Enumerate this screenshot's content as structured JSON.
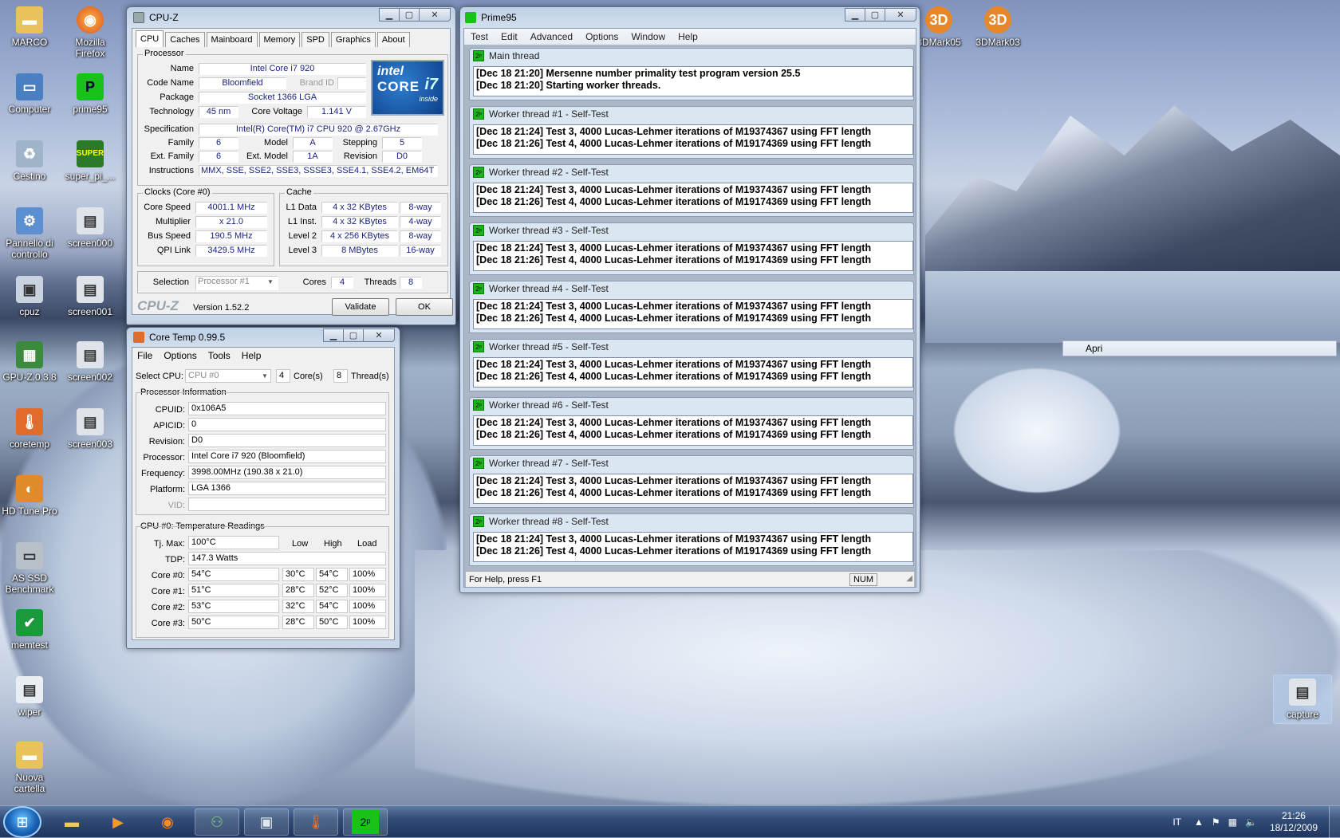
{
  "desktop_icons": [
    {
      "label": "MARCO",
      "icon": "folder-icon"
    },
    {
      "label": "Mozilla Firefox",
      "icon": "firefox-icon"
    },
    {
      "label": "Computer",
      "icon": "computer-icon"
    },
    {
      "label": "prime95",
      "icon": "prime95-icon"
    },
    {
      "label": "Cestino",
      "icon": "recycle-bin-icon"
    },
    {
      "label": "super_pi_...",
      "icon": "superpi-icon"
    },
    {
      "label": "Pannello di controllo",
      "icon": "control-panel-icon"
    },
    {
      "label": "screen000",
      "icon": "image-file-icon"
    },
    {
      "label": "cpuz",
      "icon": "cpuz-icon"
    },
    {
      "label": "screen001",
      "icon": "image-file-icon"
    },
    {
      "label": "GPU-Z.0.3.8",
      "icon": "gpuz-icon"
    },
    {
      "label": "screen002",
      "icon": "image-file-icon"
    },
    {
      "label": "coretemp",
      "icon": "coretemp-icon"
    },
    {
      "label": "screen003",
      "icon": "image-file-icon"
    },
    {
      "label": "HD Tune Pro",
      "icon": "hdtune-icon"
    },
    {
      "label": "AS SSD Benchmark",
      "icon": "asssd-icon"
    },
    {
      "label": "memtest",
      "icon": "memtest-icon"
    },
    {
      "label": "wiper",
      "icon": "wiper-icon"
    },
    {
      "label": "Nuova cartella",
      "icon": "folder-icon"
    },
    {
      "label": "3DMark05",
      "icon": "3dmark-icon"
    },
    {
      "label": "3DMark03",
      "icon": "3dmark-icon"
    },
    {
      "label": "capture",
      "icon": "image-file-icon"
    }
  ],
  "context_menu": {
    "item": "Apri"
  },
  "cpuz": {
    "title": "CPU-Z",
    "tabs": [
      "CPU",
      "Caches",
      "Mainboard",
      "Memory",
      "SPD",
      "Graphics",
      "About"
    ],
    "processor_group": "Processor",
    "labels": {
      "name": "Name",
      "code_name": "Code Name",
      "brand_id": "Brand ID",
      "package": "Package",
      "technology": "Technology",
      "core_voltage": "Core Voltage",
      "specification": "Specification",
      "family": "Family",
      "model": "Model",
      "stepping": "Stepping",
      "ext_family": "Ext. Family",
      "ext_model": "Ext. Model",
      "revision": "Revision",
      "instructions": "Instructions"
    },
    "values": {
      "name": "Intel Core i7 920",
      "code_name": "Bloomfield",
      "package": "Socket 1366 LGA",
      "technology": "45 nm",
      "core_voltage": "1.141 V",
      "specification": "Intel(R) Core(TM) i7 CPU        920  @ 2.67GHz",
      "family": "6",
      "model": "A",
      "stepping": "5",
      "ext_family": "6",
      "ext_model": "1A",
      "revision": "D0",
      "instructions": "MMX, SSE, SSE2, SSE3, SSSE3, SSE4.1, SSE4.2, EM64T"
    },
    "logo": {
      "line1": "intel",
      "line2": "CORE",
      "line3": "inside",
      "badge": "i7"
    },
    "clocks_group": "Clocks (Core #0)",
    "clocks": [
      {
        "label": "Core Speed",
        "value": "4001.1 MHz"
      },
      {
        "label": "Multiplier",
        "value": "x 21.0"
      },
      {
        "label": "Bus Speed",
        "value": "190.5 MHz"
      },
      {
        "label": "QPI Link",
        "value": "3429.5 MHz"
      }
    ],
    "cache_group": "Cache",
    "cache": [
      {
        "label": "L1 Data",
        "size": "4 x 32 KBytes",
        "way": "8-way"
      },
      {
        "label": "L1 Inst.",
        "size": "4 x 32 KBytes",
        "way": "4-way"
      },
      {
        "label": "Level 2",
        "size": "4 x 256 KBytes",
        "way": "8-way"
      },
      {
        "label": "Level 3",
        "size": "8 MBytes",
        "way": "16-way"
      }
    ],
    "selection_label": "Selection",
    "selection_value": "Processor #1",
    "cores_label": "Cores",
    "cores": "4",
    "threads_label": "Threads",
    "threads": "8",
    "brand": "CPU-Z",
    "version": "Version 1.52.2",
    "validate": "Validate",
    "ok": "OK"
  },
  "coretemp": {
    "title": "Core Temp 0.99.5",
    "menu": [
      "File",
      "Options",
      "Tools",
      "Help"
    ],
    "select_cpu_label": "Select CPU:",
    "select_cpu_value": "CPU #0",
    "cores_count": "4",
    "cores_label": "Core(s)",
    "threads_count": "8",
    "threads_label": "Thread(s)",
    "info_group": "Processor Information",
    "info": [
      {
        "label": "CPUID:",
        "value": "0x106A5"
      },
      {
        "label": "APICID:",
        "value": "0"
      },
      {
        "label": "Revision:",
        "value": "D0"
      },
      {
        "label": "Processor:",
        "value": "Intel Core i7 920 (Bloomfield)"
      },
      {
        "label": "Frequency:",
        "value": "3998.00MHz (190.38 x 21.0)"
      },
      {
        "label": "Platform:",
        "value": "LGA 1366"
      },
      {
        "label": "VID:",
        "value": ""
      }
    ],
    "temp_group": "CPU #0: Temperature Readings",
    "tjmax_label": "Tj. Max:",
    "tjmax": "100°C",
    "tdp_label": "TDP:",
    "tdp": "147.3 Watts",
    "col_low": "Low",
    "col_high": "High",
    "col_load": "Load",
    "cores": [
      {
        "label": "Core #0:",
        "temp": "54°C",
        "low": "30°C",
        "high": "54°C",
        "load": "100%"
      },
      {
        "label": "Core #1:",
        "temp": "51°C",
        "low": "28°C",
        "high": "52°C",
        "load": "100%"
      },
      {
        "label": "Core #2:",
        "temp": "53°C",
        "low": "32°C",
        "high": "54°C",
        "load": "100%"
      },
      {
        "label": "Core #3:",
        "temp": "50°C",
        "low": "28°C",
        "high": "50°C",
        "load": "100%"
      }
    ]
  },
  "prime95": {
    "title": "Prime95",
    "menu": [
      "Test",
      "Edit",
      "Advanced",
      "Options",
      "Window",
      "Help"
    ],
    "threads": [
      {
        "title": "Main thread",
        "lines": [
          "[Dec 18 21:20] Mersenne number primality test program version 25.5",
          "[Dec 18 21:20] Starting worker threads."
        ]
      },
      {
        "title": "Worker thread #1 - Self-Test",
        "lines": [
          "[Dec 18 21:24] Test 3, 4000 Lucas-Lehmer iterations of M19374367 using FFT length",
          "[Dec 18 21:26] Test 4, 4000 Lucas-Lehmer iterations of M19174369 using FFT length"
        ]
      },
      {
        "title": "Worker thread #2 - Self-Test",
        "lines": [
          "[Dec 18 21:24] Test 3, 4000 Lucas-Lehmer iterations of M19374367 using FFT length",
          "[Dec 18 21:26] Test 4, 4000 Lucas-Lehmer iterations of M19174369 using FFT length"
        ]
      },
      {
        "title": "Worker thread #3 - Self-Test",
        "lines": [
          "[Dec 18 21:24] Test 3, 4000 Lucas-Lehmer iterations of M19374367 using FFT length",
          "[Dec 18 21:26] Test 4, 4000 Lucas-Lehmer iterations of M19174369 using FFT length"
        ]
      },
      {
        "title": "Worker thread #4 - Self-Test",
        "lines": [
          "[Dec 18 21:24] Test 3, 4000 Lucas-Lehmer iterations of M19374367 using FFT length",
          "[Dec 18 21:26] Test 4, 4000 Lucas-Lehmer iterations of M19174369 using FFT length"
        ]
      },
      {
        "title": "Worker thread #5 - Self-Test",
        "lines": [
          "[Dec 18 21:24] Test 3, 4000 Lucas-Lehmer iterations of M19374367 using FFT length",
          "[Dec 18 21:26] Test 4, 4000 Lucas-Lehmer iterations of M19174369 using FFT length"
        ]
      },
      {
        "title": "Worker thread #6 - Self-Test",
        "lines": [
          "[Dec 18 21:24] Test 3, 4000 Lucas-Lehmer iterations of M19374367 using FFT length",
          "[Dec 18 21:26] Test 4, 4000 Lucas-Lehmer iterations of M19174369 using FFT length"
        ]
      },
      {
        "title": "Worker thread #7 - Self-Test",
        "lines": [
          "[Dec 18 21:24] Test 3, 4000 Lucas-Lehmer iterations of M19374367 using FFT length",
          "[Dec 18 21:26] Test 4, 4000 Lucas-Lehmer iterations of M19174369 using FFT length"
        ]
      },
      {
        "title": "Worker thread #8 - Self-Test",
        "lines": [
          "[Dec 18 21:24] Test 3, 4000 Lucas-Lehmer iterations of M19374367 using FFT length",
          "[Dec 18 21:26] Test 4, 4000 Lucas-Lehmer iterations of M19174369 using FFT length"
        ]
      }
    ],
    "status": "For Help, press F1",
    "num": "NUM"
  },
  "taskbar": {
    "lang": "IT",
    "time": "21:26",
    "date": "18/12/2009"
  }
}
